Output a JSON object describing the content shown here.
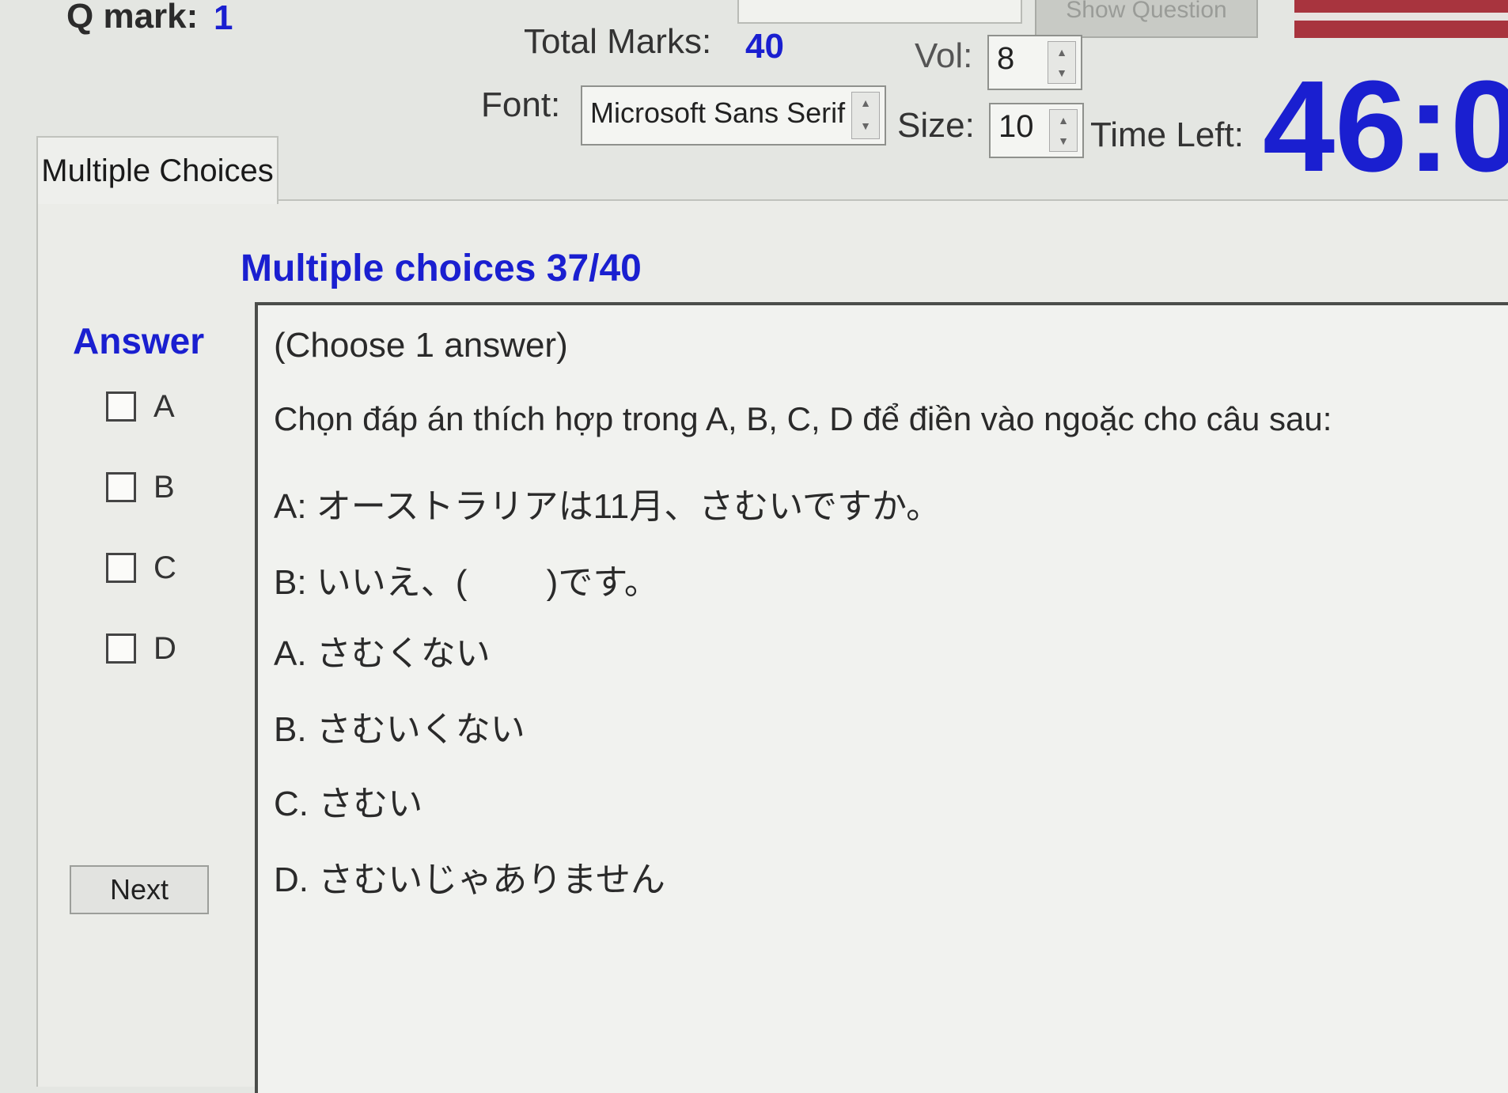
{
  "header": {
    "q_mark_label": "Q mark:",
    "q_mark_value": "1",
    "show_question_label": "Show Question",
    "total_marks_label": "Total Marks:",
    "total_marks_value": "40",
    "vol_label": "Vol:",
    "vol_value": "8",
    "font_label": "Font:",
    "font_value": "Microsoft Sans Serif",
    "size_label": "Size:",
    "size_value": "10",
    "time_left_label": "Time Left:",
    "time_left_value": "46:0"
  },
  "tab": {
    "label": "Multiple Choices"
  },
  "panel": {
    "title": "Multiple choices 37/40",
    "answer_label": "Answer",
    "options": [
      {
        "letter": "A"
      },
      {
        "letter": "B"
      },
      {
        "letter": "C"
      },
      {
        "letter": "D"
      }
    ],
    "next_label": "Next"
  },
  "question": {
    "instruction": "(Choose 1 answer)",
    "prompt": "Chọn đáp án thích hợp trong A, B, C, D để điền vào ngoặc cho câu sau:",
    "line_a": "A:  オーストラリアは11月、さむいですか。",
    "line_b": "B:  いいえ、(　　 )です。",
    "choices": [
      "A.  さむくない",
      "B.  さむいくない",
      "C.  さむい",
      "D.  さむいじゃありません"
    ]
  },
  "colors": {
    "accent_blue": "#1a1fd0",
    "background": "#e4e6e2"
  }
}
